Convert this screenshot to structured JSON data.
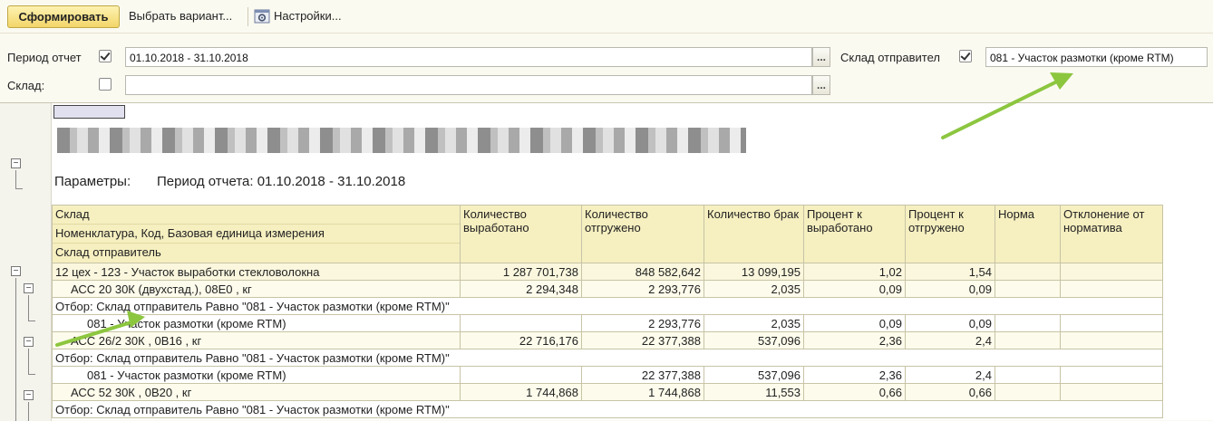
{
  "toolbar": {
    "generate_label": "Сформировать",
    "variant_label": "Выбрать вариант...",
    "settings_label": "Настройки..."
  },
  "filters": {
    "period_label": "Период отчет",
    "period_checked": true,
    "period_value": "01.10.2018 - 31.10.2018",
    "sender_label": "Склад отправител",
    "sender_checked": true,
    "sender_value": "081 - Участок размотки (кроме RTM)",
    "warehouse_label": "Склад:",
    "warehouse_checked": false,
    "warehouse_value": "",
    "browse_label": "..."
  },
  "report": {
    "params_label": "Параметры:",
    "params_value": "Период отчета: 01.10.2018 - 31.10.2018",
    "headers": {
      "warehouse": "Склад",
      "nomenclature": "Номенклатура, Код, Базовая единица измерения",
      "sender": "Склад отправитель",
      "produced": "Количество выработано",
      "shipped": "Количество отгружено",
      "defect": "Количество брак",
      "pct_produced": "Процент к выработано",
      "pct_shipped": "Процент к отгружено",
      "norm": "Норма",
      "deviation": "Отклонение от норматива"
    },
    "rows": [
      {
        "kind": "group",
        "name": "12 цех - 123 - Участок выработки стекловолокна",
        "produced": "1 287 701,738",
        "shipped": "848 582,642",
        "defect": "13 099,195",
        "pct_produced": "1,02",
        "pct_shipped": "1,54"
      },
      {
        "kind": "item",
        "name": "АСС 20 30К (двухстад.), 08Е0 , кг",
        "produced": "2 294,348",
        "shipped": "2 293,776",
        "defect": "2,035",
        "pct_produced": "0,09",
        "pct_shipped": "0,09"
      },
      {
        "kind": "filter",
        "name": "Отбор: Склад отправитель Равно \"081 - Участок размотки (кроме RTM)\""
      },
      {
        "kind": "plain",
        "name": "081 - Участок размотки (кроме RTM)",
        "produced": "",
        "shipped": "2 293,776",
        "defect": "2,035",
        "pct_produced": "0,09",
        "pct_shipped": "0,09"
      },
      {
        "kind": "item",
        "name": "АСС 26/2 30К , 0В16 , кг",
        "produced": "22 716,176",
        "shipped": "22 377,388",
        "defect": "537,096",
        "pct_produced": "2,36",
        "pct_shipped": "2,4"
      },
      {
        "kind": "filter",
        "name": "Отбор: Склад отправитель Равно \"081 - Участок размотки (кроме RTM)\""
      },
      {
        "kind": "plain",
        "name": "081 - Участок размотки (кроме RTM)",
        "produced": "",
        "shipped": "22 377,388",
        "defect": "537,096",
        "pct_produced": "2,36",
        "pct_shipped": "2,4"
      },
      {
        "kind": "item",
        "name": "АСС 52 30К , 0В20 , кг",
        "produced": "1 744,868",
        "shipped": "1 744,868",
        "defect": "11,553",
        "pct_produced": "0,66",
        "pct_shipped": "0,66"
      },
      {
        "kind": "filter",
        "name": "Отбор: Склад отправитель Равно \"081 - Участок размотки (кроме RTM)\""
      }
    ]
  },
  "colors": {
    "primary_button": "#f3d669",
    "header_fill": "#f6efc0",
    "arrow": "#8cc63f"
  }
}
